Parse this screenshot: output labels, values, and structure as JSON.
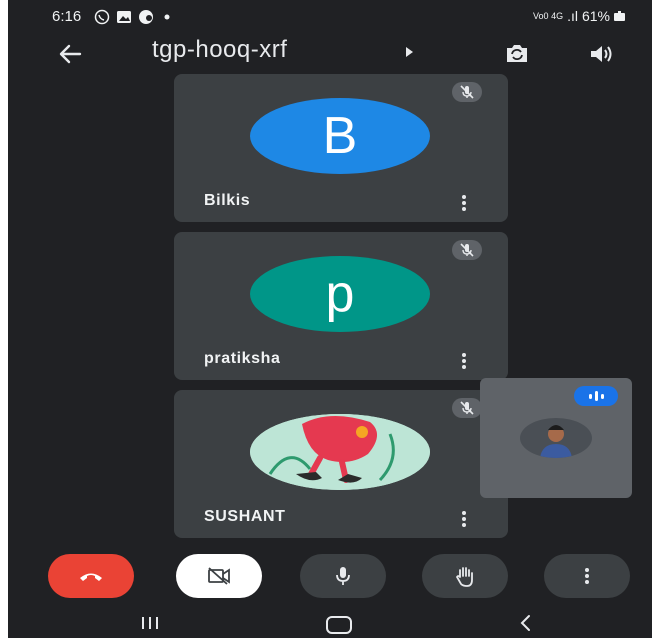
{
  "status_bar": {
    "time": "6:16",
    "network_text": "Vo0 4G",
    "signal_text": ".ıl",
    "battery": "61%"
  },
  "app_bar": {
    "meeting_code": "tgp-hooq-xrf"
  },
  "participants": [
    {
      "name": "Bilkis",
      "initial": "B",
      "color": "#1e88e5"
    },
    {
      "name": "pratiksha",
      "initial": "p",
      "color": "#009688"
    },
    {
      "name": "SUSHANT",
      "initial": "",
      "color": "#bde5d6"
    }
  ],
  "icons": {
    "back": "arrow-left-icon",
    "switch_camera": "switch-camera-icon",
    "speaker": "speaker-icon",
    "muted": "mic-off-icon",
    "more": "more-vertical-icon",
    "end_call": "phone-hangup-icon",
    "camera_off": "video-off-icon",
    "mic": "mic-icon",
    "raise_hand": "hand-icon"
  },
  "colors": {
    "background": "#202124",
    "tile": "#3c4043",
    "end_call": "#ea4335",
    "accent": "#1a73e8"
  }
}
